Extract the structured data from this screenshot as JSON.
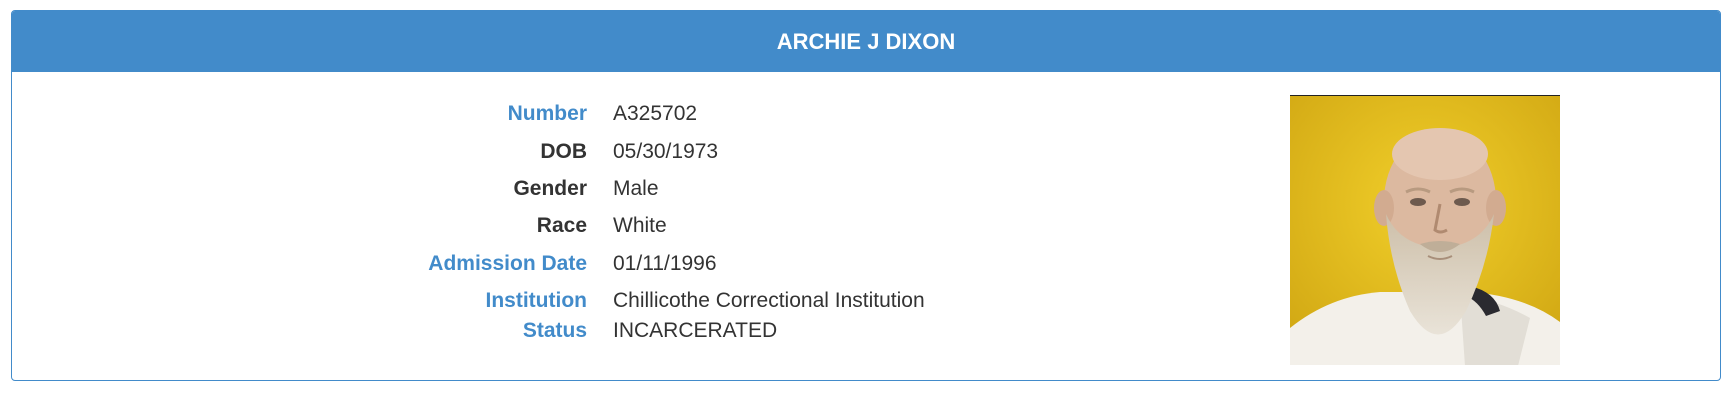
{
  "header": {
    "name": "ARCHIE J DIXON"
  },
  "fields": {
    "number": {
      "label": "Number",
      "value": "A325702"
    },
    "dob": {
      "label": "DOB",
      "value": "05/30/1973"
    },
    "gender": {
      "label": "Gender",
      "value": "Male"
    },
    "race": {
      "label": "Race",
      "value": "White"
    },
    "admission_date": {
      "label": "Admission Date",
      "value": "01/11/1996"
    },
    "institution": {
      "label": "Institution",
      "value": "Chillicothe Correctional Institution"
    },
    "status": {
      "label": "Status",
      "value": "INCARCERATED"
    }
  },
  "colors": {
    "accent": "#428bca",
    "text": "#333333",
    "photo_background": "#e8c21c"
  },
  "photo": {
    "icon": "inmate-photo"
  }
}
